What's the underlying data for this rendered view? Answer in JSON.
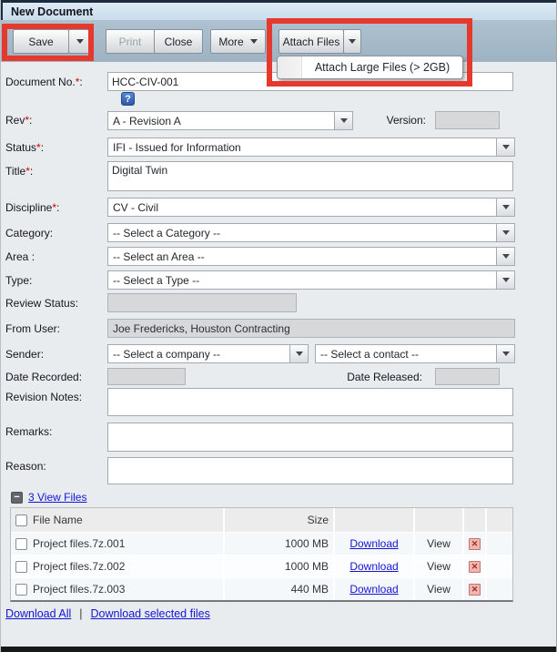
{
  "window": {
    "title": "New Document"
  },
  "toolbar": {
    "save": "Save",
    "print": "Print",
    "close": "Close",
    "more": "More",
    "attach_files": "Attach Files",
    "attach_menu_item": "Attach Large Files (> 2GB)"
  },
  "icons": {
    "help": "?",
    "collapse_minus": "−",
    "delete_x": "✕"
  },
  "colors": {
    "annotation_red": "#e6392e",
    "link_blue": "#1414d6",
    "toolbar_blue_gray": "#a4b8c8",
    "titlebar_blue": "#cfe0ee"
  },
  "form": {
    "document_no": {
      "l": "Document No.",
      "s": "*",
      "c": ":",
      "value": "HCC-CIV-001"
    },
    "rev": {
      "l": "Rev",
      "s": "*",
      "c": ":",
      "value": "A - Revision A"
    },
    "version": {
      "l": "Version",
      "s": "",
      "c": ":",
      "value": ""
    },
    "status": {
      "l": "Status",
      "s": "*",
      "c": ":",
      "value": "IFI - Issued for Information"
    },
    "title": {
      "l": "Title",
      "s": "*",
      "c": ":",
      "value": "Digital Twin"
    },
    "discipline": {
      "l": "Discipline",
      "s": "*",
      "c": ":",
      "value": "CV - Civil"
    },
    "category": {
      "l": "Category",
      "s": "",
      "c": ":",
      "value": "-- Select a Category --"
    },
    "area": {
      "l": "Area ",
      "s": "",
      "c": ":",
      "value": "-- Select an Area --"
    },
    "type": {
      "l": "Type",
      "s": "",
      "c": ":",
      "value": "-- Select a Type --"
    },
    "review_status": {
      "l": "Review Status",
      "s": "",
      "c": ":",
      "value": ""
    },
    "from_user": {
      "l": "From User",
      "s": "",
      "c": ":",
      "value": "Joe Fredericks, Houston Contracting"
    },
    "sender": {
      "l": "Sender",
      "s": "",
      "c": ":",
      "company": "-- Select a company --",
      "contact": "-- Select a contact --"
    },
    "date_recorded": {
      "l": "Date Recorded",
      "s": "",
      "c": ":",
      "value": ""
    },
    "date_released": {
      "l": "Date Released",
      "s": "",
      "c": ":",
      "value": ""
    },
    "revision_notes": {
      "l": "Revision Notes",
      "s": "",
      "c": ":",
      "value": ""
    },
    "remarks": {
      "l": "Remarks",
      "s": "",
      "c": ":",
      "value": ""
    },
    "reason": {
      "l": "Reason",
      "s": "",
      "c": ":",
      "value": ""
    }
  },
  "files": {
    "toggle_label": "3 View Files",
    "columns": {
      "name": "File Name",
      "size": "Size"
    },
    "rows": [
      {
        "name": "Project files.7z.001",
        "size": "1000 MB",
        "download": "Download",
        "view": "View"
      },
      {
        "name": "Project files.7z.002",
        "size": "1000 MB",
        "download": "Download",
        "view": "View"
      },
      {
        "name": "Project files.7z.003",
        "size": "440 MB",
        "download": "Download",
        "view": "View"
      }
    ],
    "download_all": "Download All",
    "separator": "|",
    "download_selected": "Download selected files"
  }
}
